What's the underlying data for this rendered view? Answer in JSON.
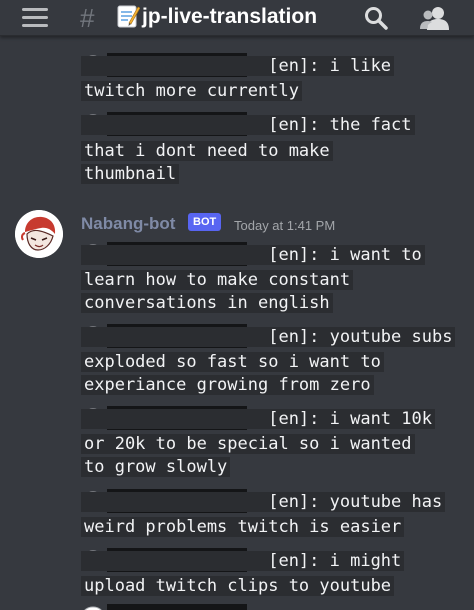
{
  "header": {
    "channel_prefix": "#",
    "channel_name": "jp-live-translation",
    "menu_icon": "hamburger-menu-icon",
    "memo_icon": "memo-emoji-icon",
    "search_icon": "search-icon",
    "members_icon": "members-icon"
  },
  "message_group_1": [
    {
      "icon": "speech-bubble-icon",
      "username_redacted": true,
      "lines": [
        "                  [en]: i like",
        "twitch more currently"
      ]
    },
    {
      "icon": "speech-bubble-icon",
      "username_redacted": true,
      "lines": [
        "                  [en]: the fact",
        "that i dont need to make",
        "thumbnail"
      ]
    }
  ],
  "author": {
    "name": "Nabang-bot",
    "tag": "BOT",
    "timestamp": "Today at 1:41 PM",
    "avatar": "user-avatar"
  },
  "message_group_2": [
    {
      "icon": "speech-bubble-icon",
      "username_redacted": true,
      "lines": [
        "                  [en]: i want to",
        "learn how to make constant",
        "conversations in english"
      ]
    },
    {
      "icon": "speech-bubble-icon",
      "username_redacted": true,
      "lines": [
        "                  [en]: youtube subs",
        "exploded so fast so i want to",
        "experiance growing from zero"
      ]
    },
    {
      "icon": "speech-bubble-icon",
      "username_redacted": true,
      "lines": [
        "                  [en]: i want 10k",
        "or 20k to be special so i wanted",
        "to grow slowly"
      ]
    },
    {
      "icon": "speech-bubble-icon",
      "username_redacted": true,
      "lines": [
        "                  [en]: youtube has",
        "weird problems twitch is easier"
      ]
    },
    {
      "icon": "speech-bubble-icon",
      "username_redacted": true,
      "lines": [
        "                  [en]: i might",
        "upload twitch clips to youtube"
      ]
    }
  ],
  "colors": {
    "background": "#36393f",
    "bot_tag": "#5865f2",
    "username": "#7f8aa6",
    "redaction": "#141517"
  }
}
